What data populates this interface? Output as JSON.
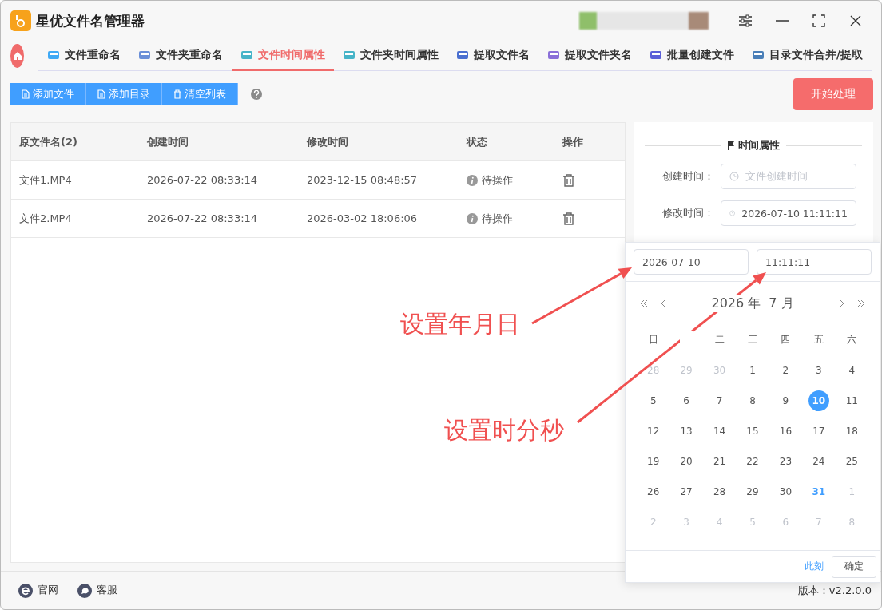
{
  "app": {
    "title": "星优文件名管理器"
  },
  "tabs": [
    {
      "label": "文件重命名",
      "selected": false
    },
    {
      "label": "文件夹重命名",
      "selected": false
    },
    {
      "label": "文件时间属性",
      "selected": true
    },
    {
      "label": "文件夹时间属性",
      "selected": false
    },
    {
      "label": "提取文件名",
      "selected": false
    },
    {
      "label": "提取文件夹名",
      "selected": false
    },
    {
      "label": "批量创建文件",
      "selected": false
    },
    {
      "label": "目录文件合并/提取",
      "selected": false
    }
  ],
  "toolbar": {
    "buttons": [
      "添加文件",
      "添加目录",
      "清空列表"
    ],
    "start_button": "开始处理"
  },
  "table": {
    "columns": [
      "原文件名(2)",
      "创建时间",
      "修改时间",
      "状态",
      "操作"
    ],
    "rows": [
      {
        "name": "文件1.MP4",
        "created": "2026-07-22 08:33:14",
        "modified": "2023-12-15 08:48:57",
        "status": "待操作"
      },
      {
        "name": "文件2.MP4",
        "created": "2026-07-22 08:33:14",
        "modified": "2026-03-02 18:06:06",
        "status": "待操作"
      }
    ]
  },
  "time_panel": {
    "title": "时间属性",
    "fields": [
      {
        "label": "创建时间：",
        "placeholder": "文件创建时间"
      },
      {
        "label": "修改时间：",
        "value": "2026-07-10 11:11:11"
      }
    ]
  },
  "date_picker": {
    "date_value": "2026-07-10",
    "time_value": "11:11:11",
    "year": "2026 年",
    "month": "7 月",
    "weekdays": [
      "日",
      "一",
      "二",
      "三",
      "四",
      "五",
      "六"
    ],
    "days": [
      {
        "label": "28",
        "kind": "prev",
        "selected": false,
        "today": false
      },
      {
        "label": "29",
        "kind": "prev",
        "selected": false,
        "today": false
      },
      {
        "label": "30",
        "kind": "prev",
        "selected": false,
        "today": false
      },
      {
        "label": "1",
        "kind": "current",
        "selected": false,
        "today": false
      },
      {
        "label": "2",
        "kind": "current",
        "selected": false,
        "today": false
      },
      {
        "label": "3",
        "kind": "current",
        "selected": false,
        "today": false
      },
      {
        "label": "4",
        "kind": "current",
        "selected": false,
        "today": false
      },
      {
        "label": "5",
        "kind": "current",
        "selected": false,
        "today": false
      },
      {
        "label": "6",
        "kind": "current",
        "selected": false,
        "today": false
      },
      {
        "label": "7",
        "kind": "current",
        "selected": false,
        "today": false
      },
      {
        "label": "8",
        "kind": "current",
        "selected": false,
        "today": false
      },
      {
        "label": "9",
        "kind": "current",
        "selected": false,
        "today": false
      },
      {
        "label": "10",
        "kind": "current",
        "selected": true,
        "today": false
      },
      {
        "label": "11",
        "kind": "current",
        "selected": false,
        "today": false
      },
      {
        "label": "12",
        "kind": "current",
        "selected": false,
        "today": false
      },
      {
        "label": "13",
        "kind": "current",
        "selected": false,
        "today": false
      },
      {
        "label": "14",
        "kind": "current",
        "selected": false,
        "today": false
      },
      {
        "label": "15",
        "kind": "current",
        "selected": false,
        "today": false
      },
      {
        "label": "16",
        "kind": "current",
        "selected": false,
        "today": false
      },
      {
        "label": "17",
        "kind": "current",
        "selected": false,
        "today": false
      },
      {
        "label": "18",
        "kind": "current",
        "selected": false,
        "today": false
      },
      {
        "label": "19",
        "kind": "current",
        "selected": false,
        "today": false
      },
      {
        "label": "20",
        "kind": "current",
        "selected": false,
        "today": false
      },
      {
        "label": "21",
        "kind": "current",
        "selected": false,
        "today": false
      },
      {
        "label": "22",
        "kind": "current",
        "selected": false,
        "today": false
      },
      {
        "label": "23",
        "kind": "current",
        "selected": false,
        "today": false
      },
      {
        "label": "24",
        "kind": "current",
        "selected": false,
        "today": false
      },
      {
        "label": "25",
        "kind": "current",
        "selected": false,
        "today": false
      },
      {
        "label": "26",
        "kind": "current",
        "selected": false,
        "today": false
      },
      {
        "label": "27",
        "kind": "current",
        "selected": false,
        "today": false
      },
      {
        "label": "28",
        "kind": "current",
        "selected": false,
        "today": false
      },
      {
        "label": "29",
        "kind": "current",
        "selected": false,
        "today": false
      },
      {
        "label": "30",
        "kind": "current",
        "selected": false,
        "today": false
      },
      {
        "label": "31",
        "kind": "current",
        "selected": false,
        "today": true
      },
      {
        "label": "1",
        "kind": "next",
        "selected": false,
        "today": false
      },
      {
        "label": "2",
        "kind": "next",
        "selected": false,
        "today": false
      },
      {
        "label": "3",
        "kind": "next",
        "selected": false,
        "today": false
      },
      {
        "label": "4",
        "kind": "next",
        "selected": false,
        "today": false
      },
      {
        "label": "5",
        "kind": "next",
        "selected": false,
        "today": false
      },
      {
        "label": "6",
        "kind": "next",
        "selected": false,
        "today": false
      },
      {
        "label": "7",
        "kind": "next",
        "selected": false,
        "today": false
      },
      {
        "label": "8",
        "kind": "next",
        "selected": false,
        "today": false
      }
    ],
    "now_button": "此刻",
    "confirm_button": "确定"
  },
  "annotations": [
    {
      "text": "设置年月日"
    },
    {
      "text": "设置时分秒"
    }
  ],
  "footer": {
    "links": [
      "官网",
      "客服"
    ],
    "version": "版本：v2.2.0.0"
  }
}
